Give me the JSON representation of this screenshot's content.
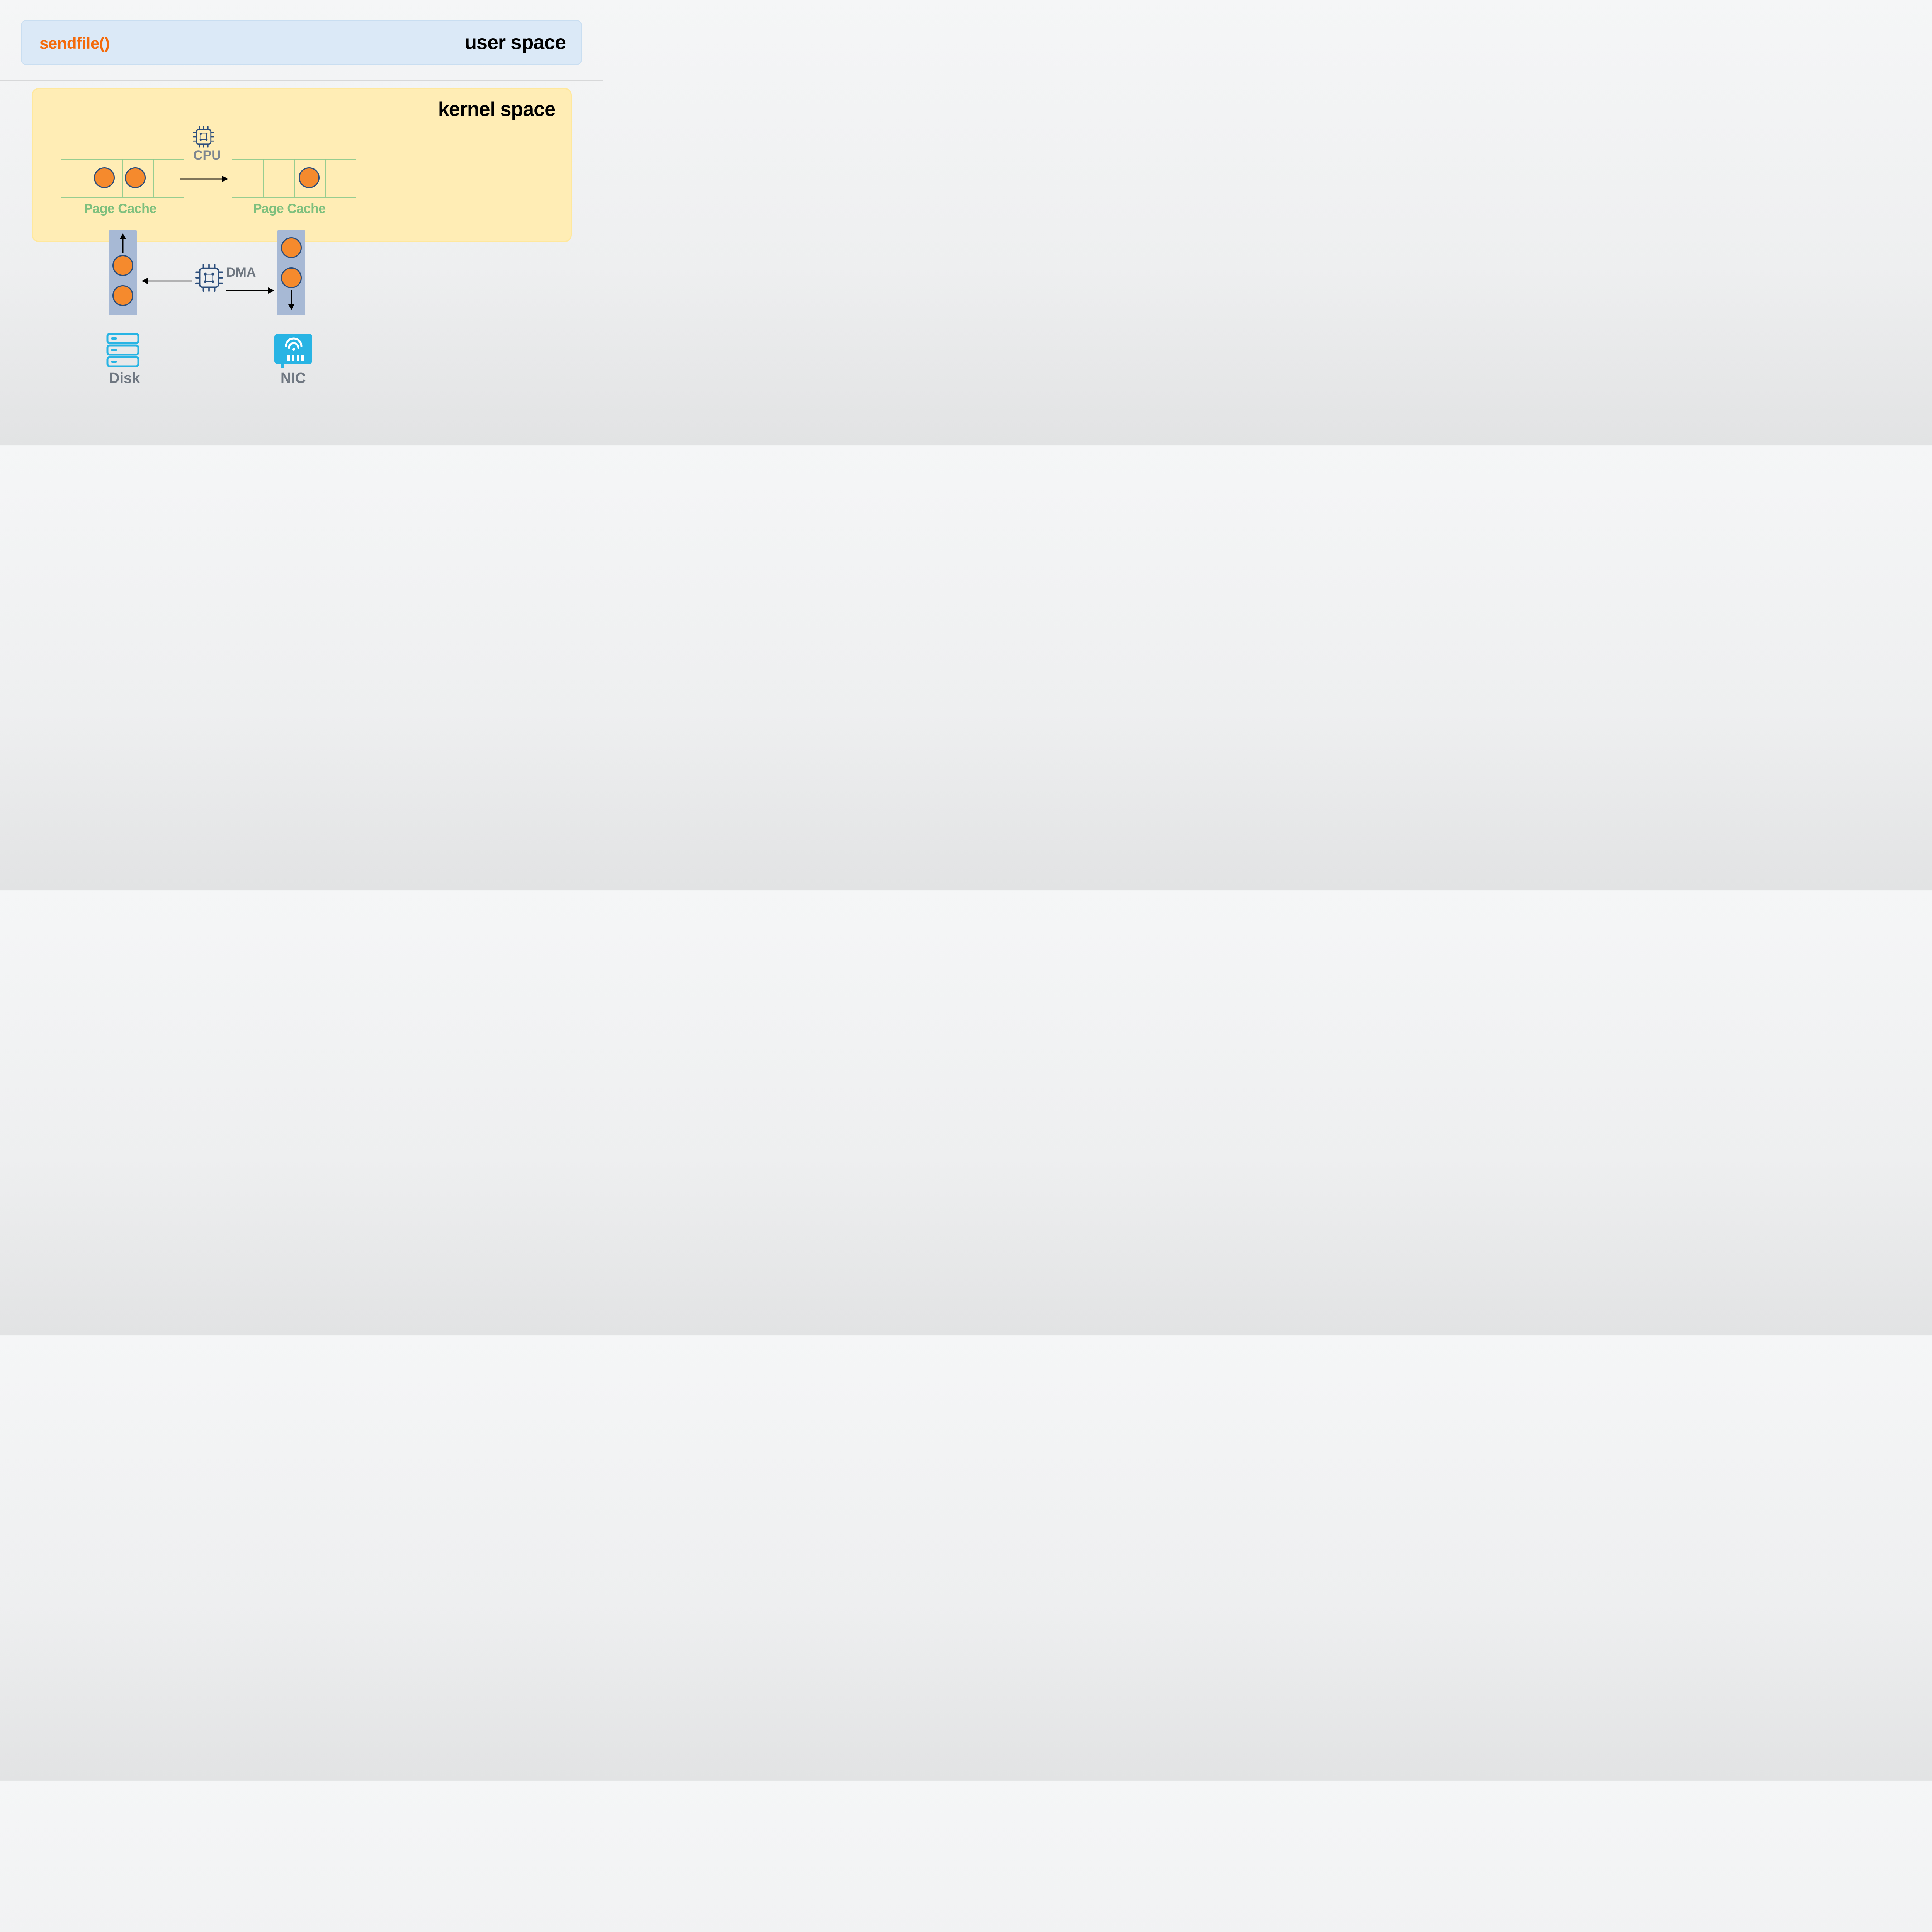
{
  "user_space": {
    "call": "sendfile()",
    "title": "user space"
  },
  "kernel_space": {
    "title": "kernel space",
    "cache_left_label": "Page Cache",
    "cache_right_label": "Page Cache",
    "cpu_label": "CPU"
  },
  "dma_label": "DMA",
  "disk_label": "Disk",
  "nic_label": "NIC",
  "colors": {
    "accent_orange": "#f46a0a",
    "dot_fill": "#f58a2d",
    "navy": "#2c4e7c",
    "cyan": "#28b4e4",
    "user_bg": "#dbe9f7",
    "kernel_bg": "#ffedb5",
    "cache_green": "#8cc98c"
  },
  "icons": {
    "cpu": "cpu-chip-icon",
    "dma": "cpu-chip-icon",
    "disk": "server-stack-icon",
    "nic": "network-card-icon"
  }
}
